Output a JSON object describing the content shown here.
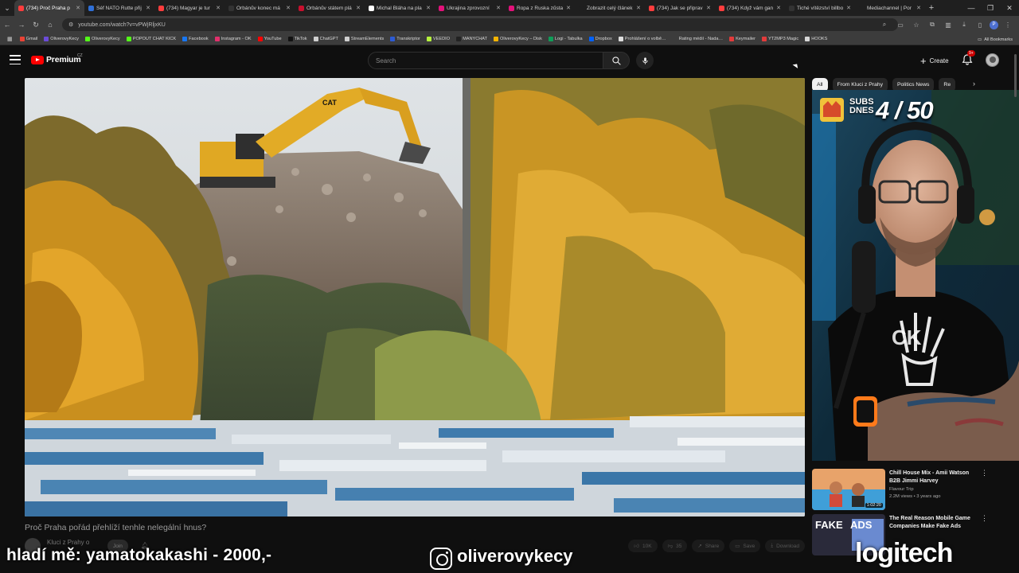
{
  "browser": {
    "tabs": [
      {
        "label": "(734) Proč Praha p",
        "color": "#ff3d3d",
        "active": true
      },
      {
        "label": "Šéf NATO Rutte přij",
        "color": "#2f6fd6"
      },
      {
        "label": "(734) Magyar je tur",
        "color": "#ff3d3d"
      },
      {
        "label": "Orbánův konec má",
        "color": "#333333"
      },
      {
        "label": "Orbánův státem plá",
        "color": "#c8102e"
      },
      {
        "label": "Michal Bláha na pla",
        "color": "#ffffff"
      },
      {
        "label": "Ukrajina zprovozní",
        "color": "#e2127a"
      },
      {
        "label": "Ropa z Ruska zůsta",
        "color": "#e2127a"
      },
      {
        "label": "Zobrazit celý článek",
        "color": "#1f1f1f"
      },
      {
        "label": "(734) Jak se připrav",
        "color": "#ff3d3d"
      },
      {
        "label": "(734) Když vám gan",
        "color": "#ff3d3d"
      },
      {
        "label": "Tiché vítězství billbo",
        "color": "#333333"
      },
      {
        "label": "Mediachannel | Por",
        "color": "#1f1f1f"
      }
    ],
    "url": "youtube.com/watch?v=vPWjRljxKU",
    "bookmarks": [
      {
        "label": "Gmail",
        "color": "#ea4335"
      },
      {
        "label": "OliverovyKecy",
        "color": "#6b4bd8"
      },
      {
        "label": "OliverovyKecy",
        "color": "#53fc18"
      },
      {
        "label": "POPOUT CHAT KICK",
        "color": "#53fc18"
      },
      {
        "label": "Facebook",
        "color": "#1877f2"
      },
      {
        "label": "Instagram - OK",
        "color": "#e1306c"
      },
      {
        "label": "YouTube",
        "color": "#ff0000"
      },
      {
        "label": "TikTok",
        "color": "#111111"
      },
      {
        "label": "ChatGPT",
        "color": "#cfcfcf"
      },
      {
        "label": "StreamElements",
        "color": "#cfcfcf"
      },
      {
        "label": "Transkriptor",
        "color": "#2d5bd3"
      },
      {
        "label": "VEEDIO",
        "color": "#b5f23d"
      },
      {
        "label": "MANYCHAT",
        "color": "#222222"
      },
      {
        "label": "OliverovyKecy – Disk",
        "color": "#f4b400"
      },
      {
        "label": "Logi - Tabulka",
        "color": "#0f9d58"
      },
      {
        "label": "Dropbox",
        "color": "#0061fe"
      },
      {
        "label": "Prohlášení o volbě…",
        "color": "#dddddd"
      },
      {
        "label": "Rating médií - Nada…",
        "color": "#3c3c3c"
      },
      {
        "label": "Keymailer",
        "color": "#e23b3b"
      },
      {
        "label": "YT2MP3 Magic",
        "color": "#e23b3b"
      },
      {
        "label": "HOOKS",
        "color": "#d8d8d8"
      }
    ],
    "all_bookmarks": "All Bookmarks"
  },
  "youtube": {
    "logo_text": "Premium",
    "country": "CZ",
    "search_placeholder": "Search",
    "create_label": "Create",
    "notif_count": "9+",
    "video_title": "Proč Praha pořád přehlíží tenhle nelegální hnus?",
    "channel_name": "Kluci z Prahy o",
    "join_label": "Join",
    "actions": [
      "10K",
      "35",
      "Share",
      "Save",
      "Download"
    ],
    "chips": [
      {
        "label": "All",
        "active": true
      },
      {
        "label": "From Kluci z Prahy"
      },
      {
        "label": "Politics News"
      },
      {
        "label": "Re"
      }
    ],
    "recommendations": [
      {
        "title": "Chill House Mix - Amii Watson B2B Jimmi Harvey",
        "channel": "Flavour Trip",
        "meta": "2.2M views • 3 years ago",
        "duration": "1:02:20"
      },
      {
        "title": "The Real Reason Mobile Game Companies Make Fake Ads",
        "channel": "Fake Ads",
        "meta": "",
        "duration": ""
      }
    ]
  },
  "overlay": {
    "donation": "hladí mě: yamatokakashi - 2000,-",
    "instagram": "oliverovykecy",
    "brand": "logitech",
    "subs_label_1": "SUBS",
    "subs_label_2": "DNES",
    "subs_count": "4 / 50"
  },
  "colors": {
    "youtube_red": "#ff0000",
    "background": "#0f0f0f"
  }
}
